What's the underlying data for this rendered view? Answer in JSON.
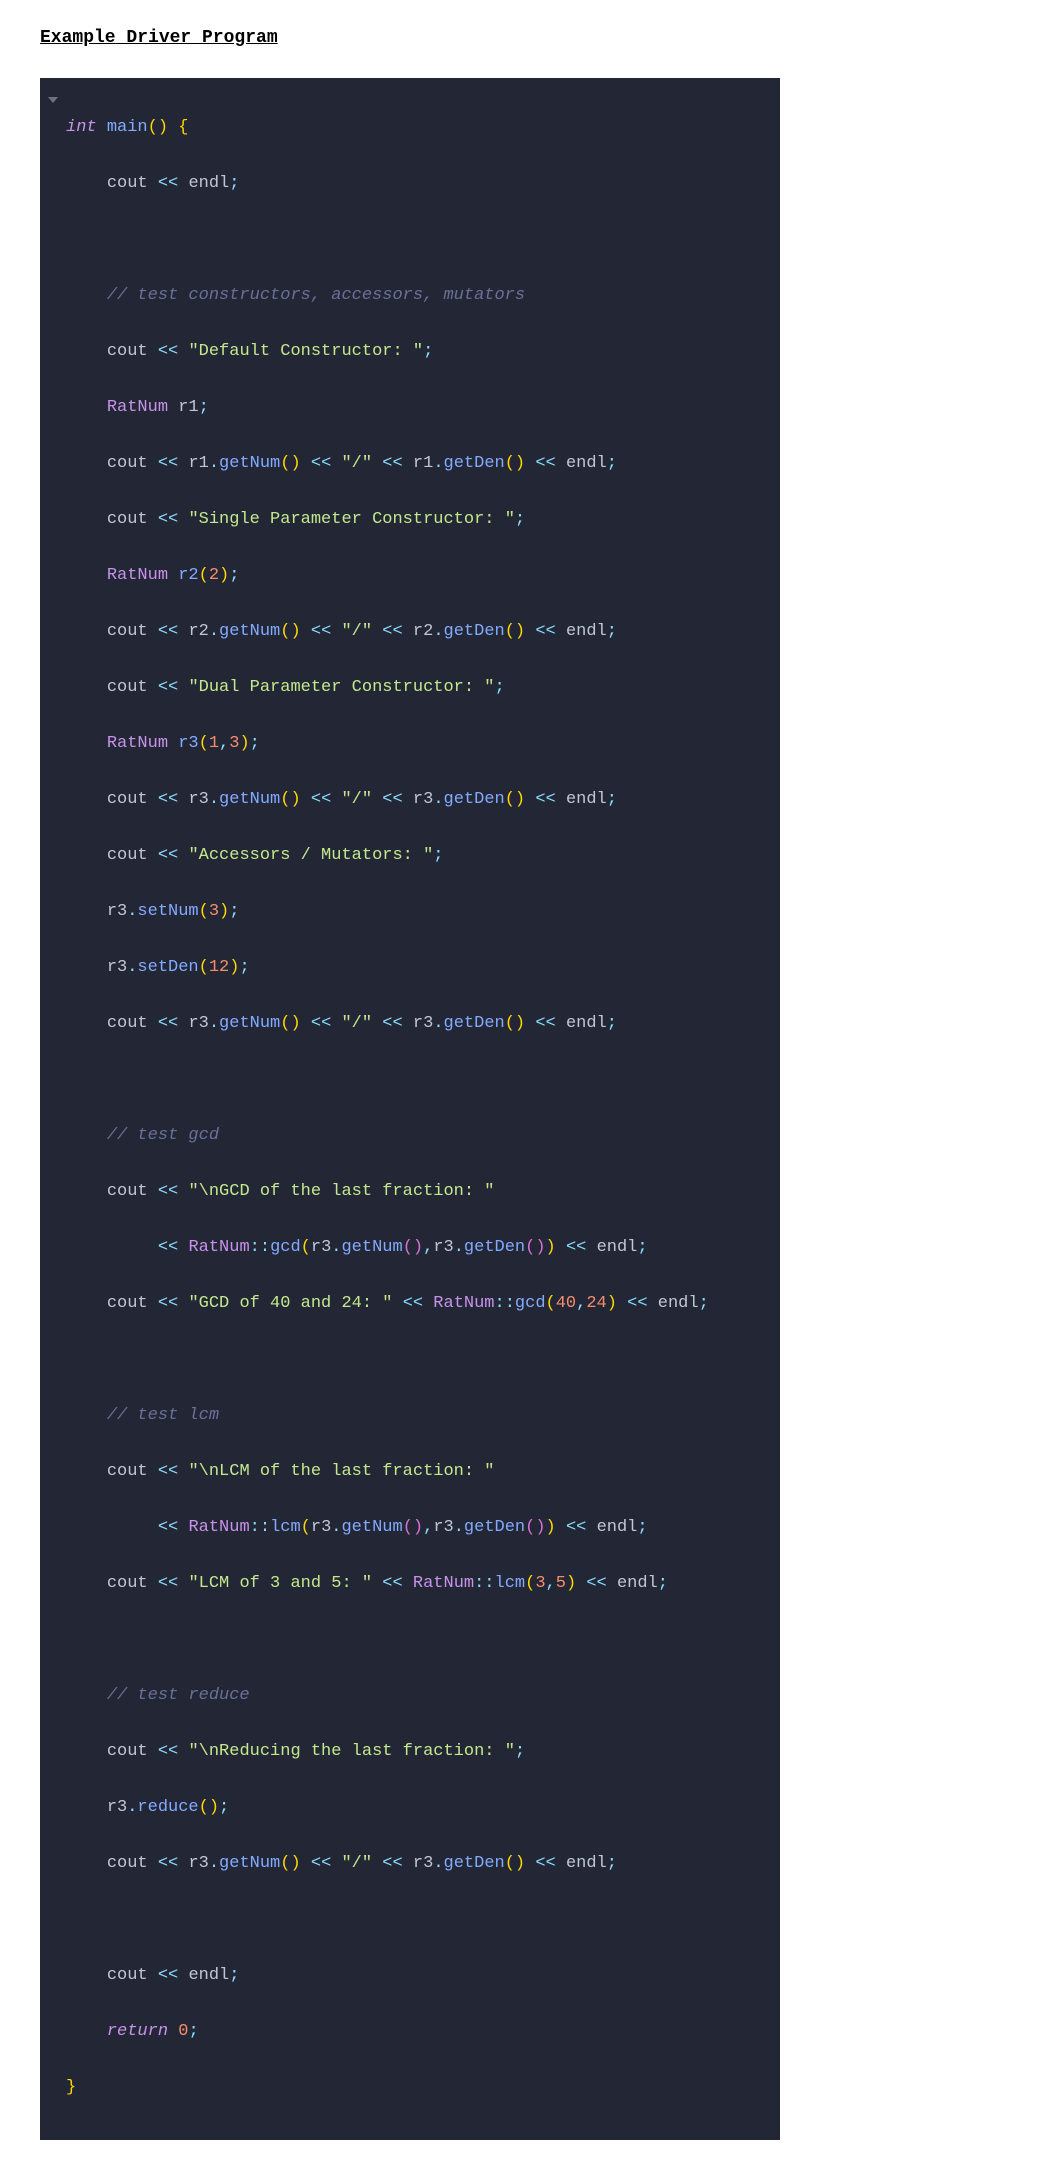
{
  "heading": "Example Driver Program",
  "code": {
    "l1": {
      "kw_int": "int",
      "main": "main",
      "op": "()",
      "brace": "{"
    },
    "l2": {
      "cout": "cout",
      "endl": "endl"
    },
    "l4c": "// test constructors, accessors, mutators",
    "l5": {
      "str": "\"Default Constructor: \""
    },
    "l6": {
      "type": "RatNum",
      "var": "r1"
    },
    "l7": {
      "r": "r1",
      "gn": "getNum",
      "gd": "getDen",
      "slash": "\"/\""
    },
    "l8": {
      "str": "\"Single Parameter Constructor: \""
    },
    "l9": {
      "type": "RatNum",
      "var": "r2",
      "arg": "2"
    },
    "l10": {
      "r": "r2",
      "gn": "getNum",
      "gd": "getDen",
      "slash": "\"/\""
    },
    "l11": {
      "str": "\"Dual Parameter Constructor: \""
    },
    "l12": {
      "type": "RatNum",
      "var": "r3",
      "a": "1",
      "b": "3"
    },
    "l13": {
      "r": "r3",
      "gn": "getNum",
      "gd": "getDen",
      "slash": "\"/\""
    },
    "l14": {
      "str": "\"Accessors / Mutators: \""
    },
    "l15": {
      "r": "r3",
      "fn": "setNum",
      "arg": "3"
    },
    "l16": {
      "r": "r3",
      "fn": "setDen",
      "arg": "12"
    },
    "l17": {
      "r": "r3",
      "gn": "getNum",
      "gd": "getDen",
      "slash": "\"/\""
    },
    "l19c": "// test gcd",
    "l20": {
      "str": "\"\\nGCD of the last fraction: \""
    },
    "l21": {
      "cls": "RatNum",
      "fn": "gcd",
      "r": "r3",
      "gn": "getNum",
      "gd": "getDen"
    },
    "l22": {
      "str": "\"GCD of 40 and 24: \"",
      "cls": "RatNum",
      "fn": "gcd",
      "a": "40",
      "b": "24"
    },
    "l24c": "// test lcm",
    "l25": {
      "str": "\"\\nLCM of the last fraction: \""
    },
    "l26": {
      "cls": "RatNum",
      "fn": "lcm",
      "r": "r3",
      "gn": "getNum",
      "gd": "getDen"
    },
    "l27": {
      "str": "\"LCM of 3 and 5: \"",
      "cls": "RatNum",
      "fn": "lcm",
      "a": "3",
      "b": "5"
    },
    "l29c": "// test reduce",
    "l30": {
      "str": "\"\\nReducing the last fraction: \""
    },
    "l31": {
      "r": "r3",
      "fn": "reduce"
    },
    "l32": {
      "r": "r3",
      "gn": "getNum",
      "gd": "getDen",
      "slash": "\"/\""
    },
    "l34": {
      "cout": "cout",
      "endl": "endl"
    },
    "l35": {
      "kw": "return",
      "val": "0"
    },
    "l36": {
      "brace": "}"
    }
  }
}
